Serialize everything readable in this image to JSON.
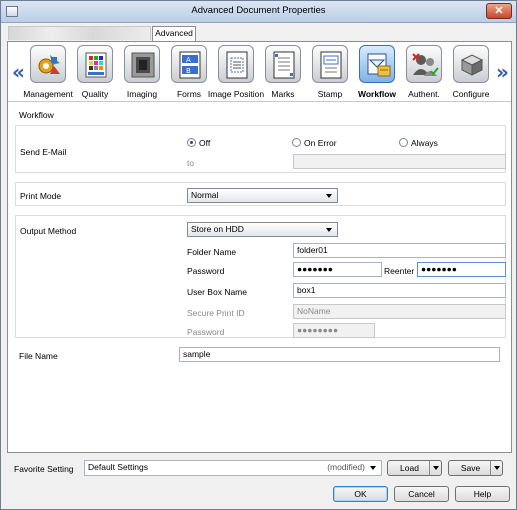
{
  "window": {
    "title": "Advanced Document Properties",
    "close_label": "✕"
  },
  "tabs": {
    "active_label": "Advanced"
  },
  "categories": [
    {
      "label": "Management",
      "icon": "management-icon"
    },
    {
      "label": "Quality",
      "icon": "quality-icon"
    },
    {
      "label": "Imaging",
      "icon": "imaging-icon"
    },
    {
      "label": "Forms",
      "icon": "forms-icon"
    },
    {
      "label": "Image Position",
      "icon": "image-position-icon"
    },
    {
      "label": "Marks",
      "icon": "marks-icon"
    },
    {
      "label": "Stamp",
      "icon": "stamp-icon"
    },
    {
      "label": "Workflow",
      "icon": "workflow-icon",
      "active": true
    },
    {
      "label": "Authent.",
      "icon": "authentication-icon"
    },
    {
      "label": "Configure",
      "icon": "configure-icon"
    }
  ],
  "nav": {
    "left_arrow": "«",
    "right_arrow": "»"
  },
  "workflow": {
    "heading": "Workflow",
    "send_email": {
      "label": "Send E-Mail",
      "options": [
        "Off",
        "On Error",
        "Always"
      ],
      "selected": "Off",
      "to_label": "to",
      "to_value": ""
    },
    "print_mode": {
      "label": "Print Mode",
      "value": "Normal"
    },
    "output_method": {
      "label": "Output Method",
      "value": "Store on HDD",
      "folder_name_label": "Folder Name",
      "folder_name_value": "folder01",
      "password_label": "Password",
      "password_value": "●●●●●●●",
      "reenter_label": "Reenter",
      "reenter_value": "●●●●●●●",
      "user_box_label": "User Box Name",
      "user_box_value": "box1",
      "secure_id_label": "Secure Print ID",
      "secure_id_value": "NoName",
      "secure_pw_label": "Password",
      "secure_pw_value": "●●●●●●●●"
    },
    "file_name": {
      "label": "File Name",
      "value": "sample"
    }
  },
  "favorite": {
    "label": "Favorite Setting",
    "value": "Default Settings",
    "status": "(modified)",
    "load_label": "Load",
    "save_label": "Save"
  },
  "buttons": {
    "ok": "OK",
    "cancel": "Cancel",
    "help": "Help"
  }
}
